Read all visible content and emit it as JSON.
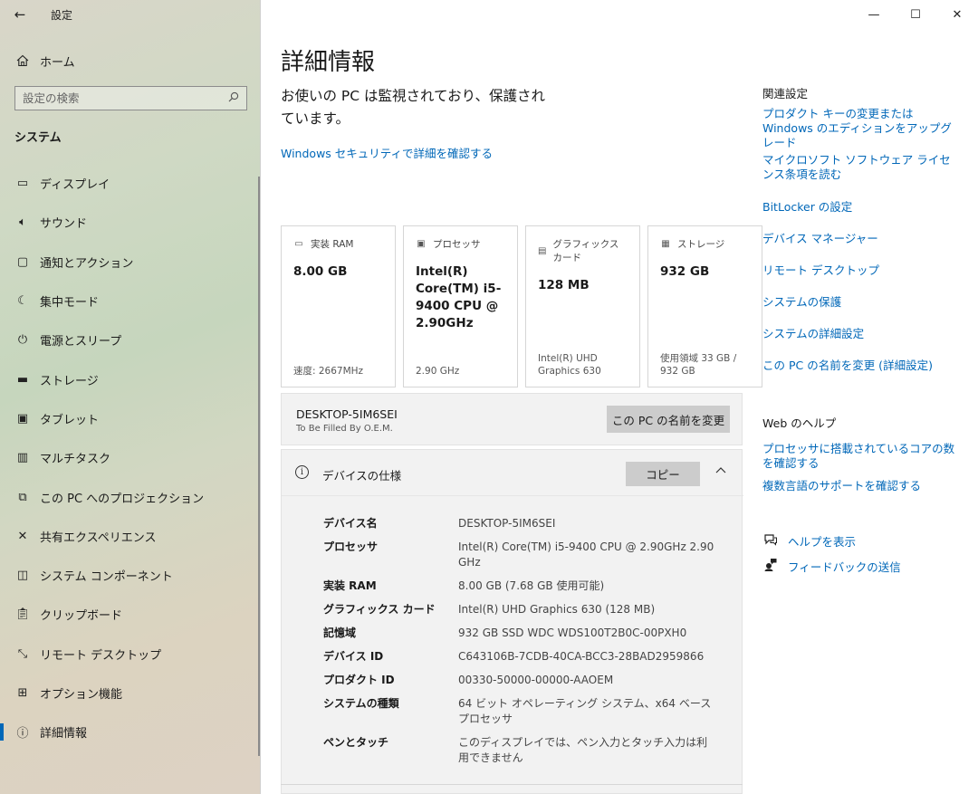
{
  "window": {
    "app_title": "設定",
    "minimize_glyph": "—",
    "maximize_glyph": "☐",
    "close_glyph": "✕"
  },
  "sidebar": {
    "home_label": "ホーム",
    "search_placeholder": "設定の検索",
    "section_heading": "システム",
    "items": [
      {
        "label": "ディスプレイ",
        "icon": "display-icon"
      },
      {
        "label": "サウンド",
        "icon": "sound-icon"
      },
      {
        "label": "通知とアクション",
        "icon": "notification-icon"
      },
      {
        "label": "集中モード",
        "icon": "moon-icon"
      },
      {
        "label": "電源とスリープ",
        "icon": "power-icon"
      },
      {
        "label": "ストレージ",
        "icon": "storage-icon"
      },
      {
        "label": "タブレット",
        "icon": "tablet-icon"
      },
      {
        "label": "マルチタスク",
        "icon": "multitask-icon"
      },
      {
        "label": "この PC へのプロジェクション",
        "icon": "projection-icon"
      },
      {
        "label": "共有エクスペリエンス",
        "icon": "share-icon"
      },
      {
        "label": "システム コンポーネント",
        "icon": "components-icon"
      },
      {
        "label": "クリップボード",
        "icon": "clipboard-icon"
      },
      {
        "label": "リモート デスクトップ",
        "icon": "remote-icon"
      },
      {
        "label": "オプション機能",
        "icon": "grid-plus-icon"
      },
      {
        "label": "詳細情報",
        "icon": "info-icon",
        "active": true
      }
    ]
  },
  "main": {
    "title": "詳細情報",
    "protect_text": "お使いの PC は監視されており、保護されています。",
    "security_link": "Windows セキュリティで詳細を確認する",
    "cards": [
      {
        "label": "実装 RAM",
        "value": "8.00 GB",
        "sub": "速度: 2667MHz",
        "icon": "ram-icon"
      },
      {
        "label": "プロセッサ",
        "value": "Intel(R) Core(TM) i5-9400 CPU @ 2.90GHz",
        "sub": "2.90 GHz",
        "icon": "cpu-icon"
      },
      {
        "label": "グラフィックス カード",
        "value": "128 MB",
        "sub": "Intel(R) UHD Graphics 630",
        "icon": "gpu-icon"
      },
      {
        "label": "ストレージ",
        "value": "932 GB",
        "sub": "使用領域 33 GB / 932 GB",
        "icon": "disk-icon"
      }
    ],
    "device_name": "DESKTOP-5IM6SEI",
    "oem": "To Be Filled By O.E.M.",
    "rename_button": "この PC の名前を変更",
    "spec_title": "デバイスの仕様",
    "copy_button": "コピー",
    "specs": [
      {
        "label": "デバイス名",
        "value": "DESKTOP-5IM6SEI"
      },
      {
        "label": "プロセッサ",
        "value": "Intel(R) Core(TM) i5-9400 CPU @ 2.90GHz   2.90 GHz"
      },
      {
        "label": "実装 RAM",
        "value": "8.00 GB (7.68 GB 使用可能)"
      },
      {
        "label": "グラフィックス カード",
        "value": "Intel(R) UHD Graphics 630 (128 MB)"
      },
      {
        "label": "記憶域",
        "value": "932 GB SSD WDC WDS100T2B0C-00PXH0"
      },
      {
        "label": "デバイス ID",
        "value": "C643106B-7CDB-40CA-BCC3-28BAD2959866"
      },
      {
        "label": "プロダクト ID",
        "value": "00330-50000-00000-AAOEM"
      },
      {
        "label": "システムの種類",
        "value": "64 ビット オペレーティング システム、x64 ベース プロセッサ"
      },
      {
        "label": "ペンとタッチ",
        "value": "このディスプレイでは、ペン入力とタッチ入力は利用できません"
      }
    ]
  },
  "related": {
    "heading": "関連設定",
    "links": [
      "プロダクト キーの変更または Windows のエディションをアップグレード",
      "マイクロソフト ソフトウェア ライセンス条項を読む",
      "BitLocker の設定",
      "デバイス マネージャー",
      "リモート デスクトップ",
      "システムの保護",
      "システムの詳細設定",
      "この PC の名前を変更 (詳細設定)"
    ],
    "web_heading": "Web のヘルプ",
    "web_links": [
      "プロセッサに搭載されているコアの数を確認する",
      "複数言語のサポートを確認する"
    ],
    "help_link": "ヘルプを表示",
    "feedback_link": "フィードバックの送信"
  },
  "colors": {
    "accent": "#0067b8",
    "button_gray": "#cccccc",
    "panel_gray": "#f2f2f2"
  }
}
